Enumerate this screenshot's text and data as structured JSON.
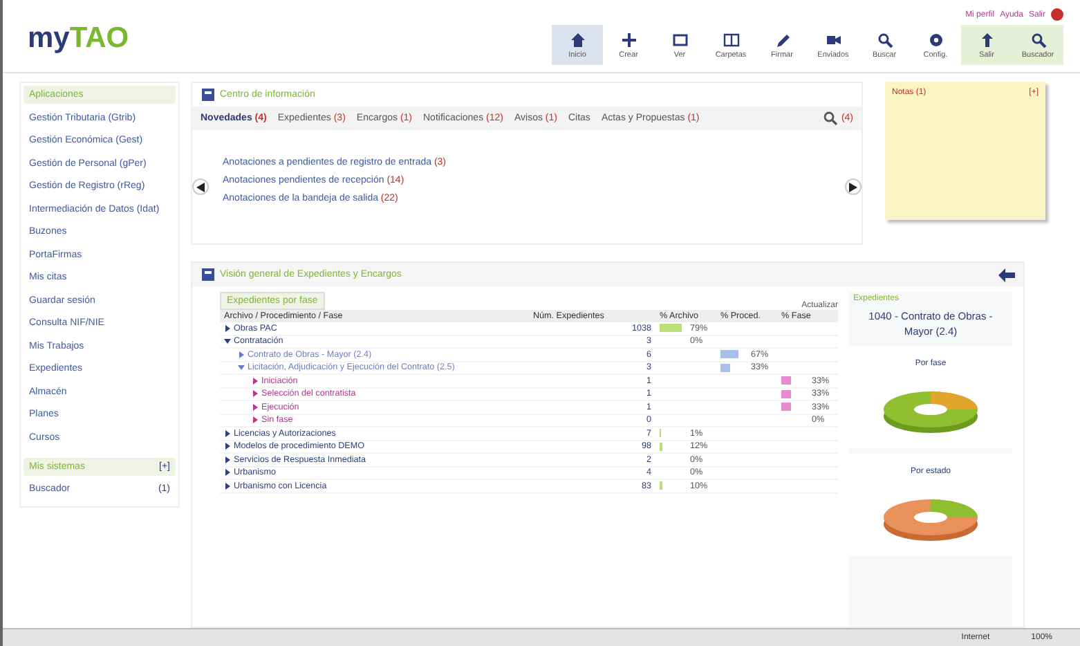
{
  "header": {
    "logo_left": "my",
    "logo_right": "TAO",
    "user_links": [
      "Mi perfil",
      "Ayuda",
      "Salir"
    ],
    "toolbar": [
      {
        "label": "Inicio",
        "selected": true
      },
      {
        "label": "Crear",
        "selected": false
      },
      {
        "label": "Ver",
        "selected": false
      },
      {
        "label": "Carpetas",
        "selected": false
      },
      {
        "label": "Firmar",
        "selected": false
      },
      {
        "label": "Enviados",
        "selected": false
      },
      {
        "label": "Buscar",
        "selected": false
      },
      {
        "label": "Config.",
        "selected": false
      },
      {
        "label": "Salir",
        "selected": false
      },
      {
        "label": "Buscador",
        "selected": false
      }
    ]
  },
  "sidebar": {
    "title": "Aplicaciones",
    "items": [
      "Gestión Tributaria (Gtrib)",
      "Gestión Económica (Gest)",
      "Gestión de Personal (gPer)",
      "Gestión de Registro (rReg)",
      "Intermediación de Datos (Idat)",
      "Buzones",
      "PortaFirmas",
      "Mis citas",
      "Guardar sesión",
      "Consulta NIF/NIE",
      "Mis Trabajos",
      "Expedientes",
      "Almacén",
      "Planes",
      "Cursos"
    ],
    "section2": {
      "title": "Mis sistemas",
      "toggle": "[+]",
      "items": [
        {
          "label": "Buscador",
          "count": "(1)"
        }
      ]
    }
  },
  "info_center": {
    "title": "Centro de información",
    "tabs": [
      {
        "label": "Novedades",
        "count": "(4)",
        "selected": true
      },
      {
        "label": "Expedientes",
        "count": "(3)",
        "selected": false
      },
      {
        "label": "Encargos",
        "count": "(1)",
        "selected": false
      },
      {
        "label": "Notificaciones",
        "count": "(12)",
        "selected": false
      },
      {
        "label": "Avisos",
        "count": "(1)",
        "selected": false
      },
      {
        "label": "Citas",
        "selected": false
      },
      {
        "label": "Actas y Propuestas",
        "count": "(1)",
        "selected": false
      }
    ],
    "zoom_count": "(4)",
    "links": [
      {
        "label": "Anotaciones a pendientes de registro de entrada",
        "count": "(3)"
      },
      {
        "label": "Anotaciones pendientes de recepción",
        "count": "(14)"
      },
      {
        "label": "Anotaciones de la bandeja de salida",
        "count": "(22)"
      }
    ]
  },
  "notes": {
    "title": "Notas (1)",
    "toggle": "[+]"
  },
  "overview": {
    "title": "Visión general de Expedientes y Encargos",
    "tab": "Expedientes por fase",
    "refresh": "Actualizar",
    "columns": [
      "Archivo / Procedimiento / Fase",
      "Núm. Expedientes",
      "% Archivo",
      "% Proced.",
      "% Fase"
    ],
    "rows": [
      {
        "label": "Obras PAC",
        "count": "1038",
        "percent": "79%",
        "expanded": false
      },
      {
        "label": "Contratación",
        "count": "3",
        "percent": "0%",
        "expanded": true,
        "children": [
          {
            "label": "Contrato de Obras - Mayor (2.4)",
            "count": "6",
            "percent": "67%",
            "expanded": false
          },
          {
            "label": "Licitación, Adjudicación y Ejecución del Contrato (2.5)",
            "count": "3",
            "percent": "33%",
            "expanded": true,
            "children": [
              {
                "label": "Iniciación",
                "count": "1",
                "percent": "33%",
                "expanded": false
              },
              {
                "label": "Selección del contratista",
                "count": "1",
                "percent": "33%",
                "expanded": false
              },
              {
                "label": "Ejecución",
                "count": "1",
                "percent": "33%",
                "expanded": false
              },
              {
                "label": "Sin fase",
                "count": "0",
                "percent": "0%",
                "expanded": false
              }
            ]
          }
        ]
      },
      {
        "label": "Licencias y Autorizaciones",
        "count": "7",
        "percent": "1%",
        "expanded": false
      },
      {
        "label": "Modelos de procedimiento DEMO",
        "count": "98",
        "percent": "12%",
        "expanded": false
      },
      {
        "label": "Servicios de Respuesta Inmediata",
        "count": "2",
        "percent": "0%",
        "expanded": false
      },
      {
        "label": "Urbanismo",
        "count": "4",
        "percent": "0%",
        "expanded": false
      },
      {
        "label": "Urbanismo con Licencia",
        "count": "83",
        "percent": "10%",
        "expanded": false
      }
    ]
  },
  "side_chart": {
    "title": "Expedientes",
    "subject": "1040 - Contrato de Obras - Mayor (2.4)",
    "charts": [
      "Por fase",
      "Por estado"
    ]
  },
  "status_bar": {
    "zone": "Internet",
    "zoom": "100%"
  }
}
